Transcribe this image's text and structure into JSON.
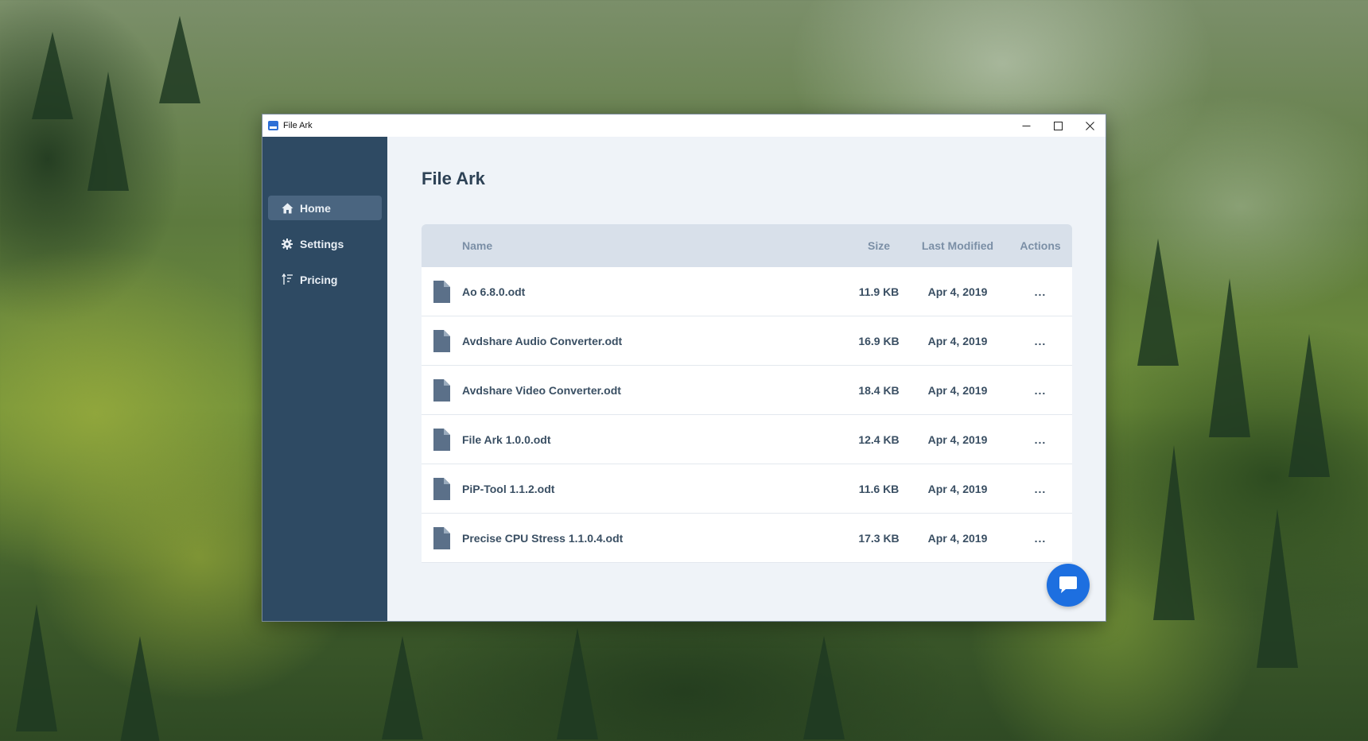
{
  "window": {
    "title": "File Ark",
    "controls": {
      "minimize": "—",
      "maximize": "□",
      "close": "✕"
    }
  },
  "sidebar": {
    "items": [
      {
        "label": "Home",
        "icon": "home-icon",
        "active": true
      },
      {
        "label": "Settings",
        "icon": "gear-icon",
        "active": false
      },
      {
        "label": "Pricing",
        "icon": "pricing-icon",
        "active": false
      }
    ]
  },
  "main": {
    "title": "File Ark",
    "table": {
      "headers": {
        "name": "Name",
        "size": "Size",
        "modified": "Last Modified",
        "actions": "Actions"
      },
      "rows": [
        {
          "name": "Ao 6.8.0.odt",
          "size": "11.9 KB",
          "modified": "Apr 4, 2019",
          "actions": "..."
        },
        {
          "name": "Avdshare Audio Converter.odt",
          "size": "16.9 KB",
          "modified": "Apr 4, 2019",
          "actions": "..."
        },
        {
          "name": "Avdshare Video Converter.odt",
          "size": "18.4 KB",
          "modified": "Apr 4, 2019",
          "actions": "..."
        },
        {
          "name": "File Ark 1.0.0.odt",
          "size": "12.4 KB",
          "modified": "Apr 4, 2019",
          "actions": "..."
        },
        {
          "name": "PiP-Tool 1.1.2.odt",
          "size": "11.6 KB",
          "modified": "Apr 4, 2019",
          "actions": "..."
        },
        {
          "name": "Precise CPU Stress 1.1.0.4.odt",
          "size": "17.3 KB",
          "modified": "Apr 4, 2019",
          "actions": "..."
        }
      ]
    },
    "chat_button": {
      "icon": "chat-icon"
    }
  },
  "colors": {
    "sidebar": "#2e4a63",
    "sidebar_active": "#4a6580",
    "accent": "#1d6fe0",
    "content_bg": "#eff3f8",
    "table_header": "#d8e0ea"
  }
}
